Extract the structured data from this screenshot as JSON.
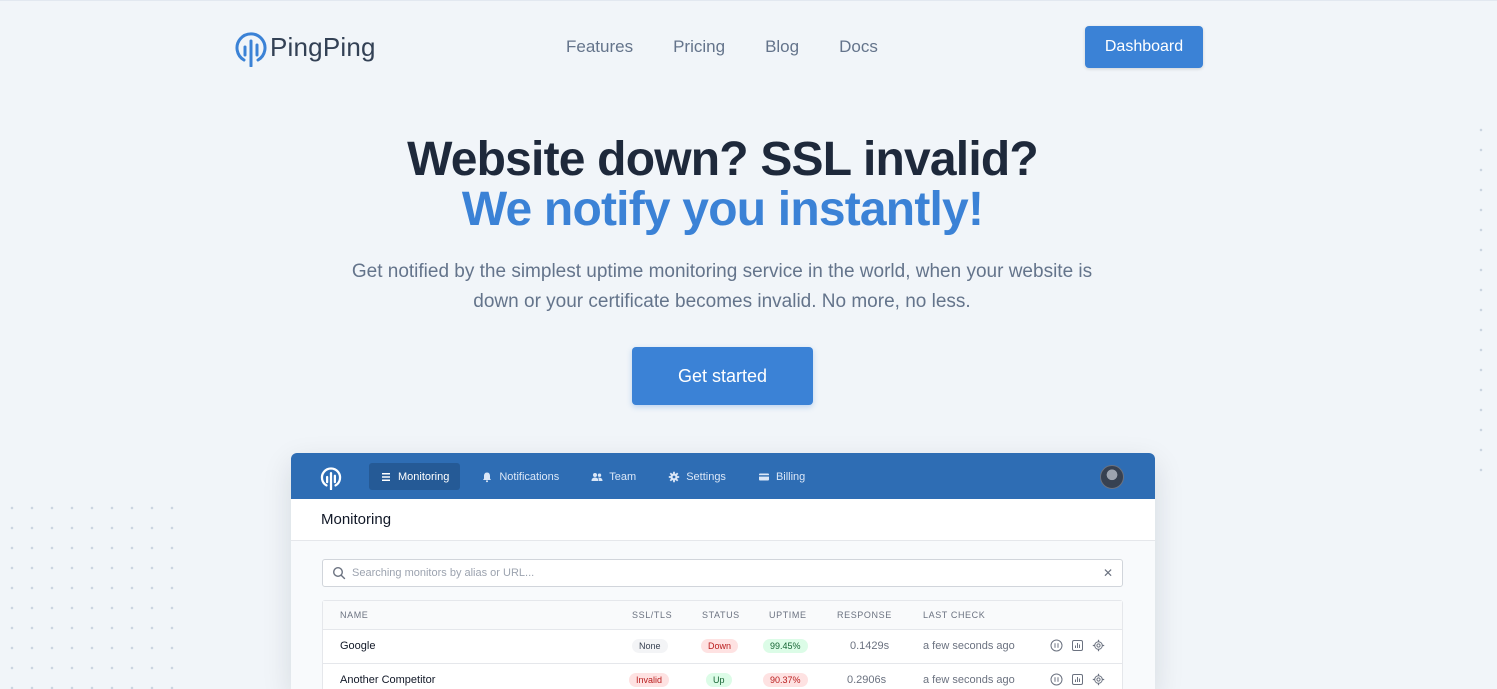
{
  "brand": {
    "name": "PingPing",
    "accent": "#3b82d6"
  },
  "nav": [
    {
      "label": "Features"
    },
    {
      "label": "Pricing"
    },
    {
      "label": "Blog"
    },
    {
      "label": "Docs"
    }
  ],
  "header": {
    "dashboard_label": "Dashboard"
  },
  "hero": {
    "title_line1": "Website down? SSL invalid?",
    "title_line2": "We notify you instantly!",
    "subtitle": "Get notified by the simplest uptime monitoring service in the world, when your website is down or your certificate becomes invalid. No more, no less.",
    "cta_label": "Get started"
  },
  "app": {
    "nav": [
      {
        "label": "Monitoring",
        "icon": "list-icon",
        "active": true
      },
      {
        "label": "Notifications",
        "icon": "bell-icon"
      },
      {
        "label": "Team",
        "icon": "users-icon"
      },
      {
        "label": "Settings",
        "icon": "gear-icon"
      },
      {
        "label": "Billing",
        "icon": "card-icon"
      }
    ],
    "page_title": "Monitoring",
    "search_placeholder": "Searching monitors by alias or URL...",
    "columns": [
      "NAME",
      "SSL/TLS",
      "STATUS",
      "UPTIME",
      "RESPONSE",
      "LAST CHECK"
    ],
    "rows": [
      {
        "name": "Google",
        "ssl": "None",
        "status": "Down",
        "uptime": "99.45%",
        "response": "0.1429s",
        "last_check": "a few seconds ago"
      },
      {
        "name": "Another Competitor",
        "ssl": "Invalid",
        "status": "Up",
        "uptime": "90.37%",
        "response": "0.2906s",
        "last_check": "a few seconds ago"
      }
    ]
  }
}
